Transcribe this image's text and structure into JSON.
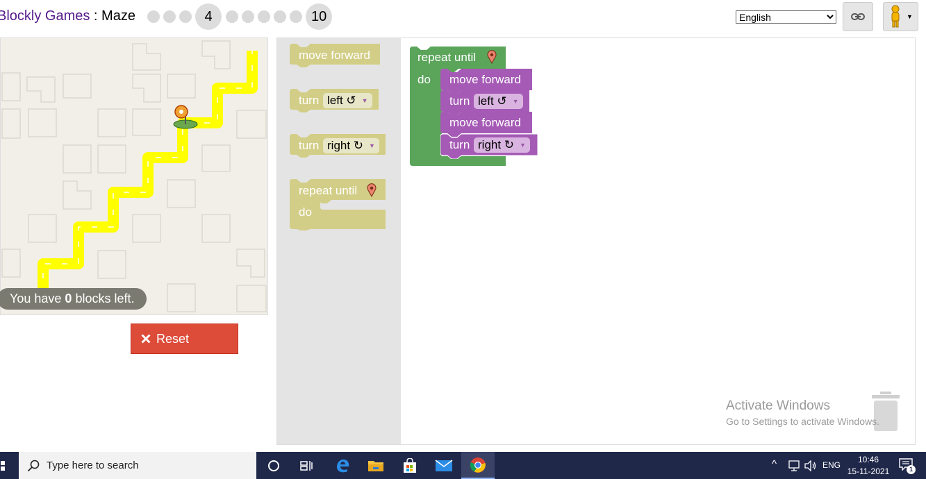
{
  "header": {
    "app_name": "Blockly Games",
    "separator": " : ",
    "page_name": "Maze",
    "level_current": "4",
    "level_last": "10",
    "language": "English",
    "language_options": [
      "English"
    ]
  },
  "maze": {
    "blocks_left_prefix": "You have ",
    "blocks_left_count": "0",
    "blocks_left_suffix": " blocks left.",
    "reset_label": "Reset"
  },
  "toolbox": {
    "move_forward": "move forward",
    "turn_left_label": "turn",
    "turn_left_value": "left ↺",
    "turn_right_label": "turn",
    "turn_right_value": "right ↻",
    "repeat_until": "repeat until",
    "do": "do"
  },
  "program": {
    "repeat_until": "repeat until",
    "do": "do",
    "stmt1": "move forward",
    "stmt2_label": "turn",
    "stmt2_value": "left ↺",
    "stmt3": "move forward",
    "stmt4_label": "turn",
    "stmt4_value": "right ↻"
  },
  "watermark": {
    "line1": "Activate Windows",
    "line2": "Go to Settings to activate Windows."
  },
  "taskbar": {
    "search_placeholder": "Type here to search",
    "language": "ENG",
    "time": "10:46",
    "date": "15-11-2021",
    "notification_count": "1"
  },
  "colors": {
    "motion_block": "#a55ab5",
    "loop_block": "#5ba55b",
    "reset_button": "#dd4b39",
    "path": "#ffff00",
    "taskbar": "#20284a"
  }
}
